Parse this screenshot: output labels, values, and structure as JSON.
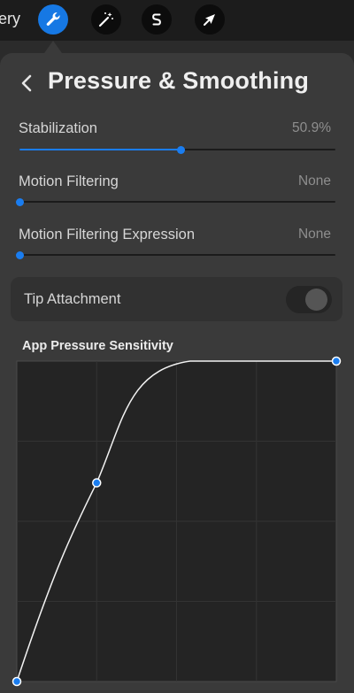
{
  "toolbar": {
    "gallery_label": "ery",
    "tools": [
      {
        "icon": "wrench-icon",
        "active": true
      },
      {
        "icon": "magic-wand-icon",
        "active": false
      },
      {
        "icon": "selection-icon",
        "active": false
      },
      {
        "icon": "transform-arrow-icon",
        "active": false
      }
    ]
  },
  "panel": {
    "title": "Pressure & Smoothing",
    "back_icon": "chevron-left-icon"
  },
  "settings": {
    "stabilization": {
      "label": "Stabilization",
      "value_text": "50.9%",
      "value": 0.509
    },
    "motion_filtering": {
      "label": "Motion Filtering",
      "value_text": "None",
      "value": 0
    },
    "motion_filtering_expression": {
      "label": "Motion Filtering Expression",
      "value_text": "None",
      "value": 0
    }
  },
  "tip_attachment": {
    "label": "Tip Attachment",
    "enabled": false
  },
  "pressure_curve": {
    "title": "App Pressure Sensitivity",
    "control_points": [
      [
        0,
        0
      ],
      [
        0.25,
        0.62
      ],
      [
        1,
        1
      ]
    ],
    "accent": "#1a7df0"
  },
  "colors": {
    "accent": "#1678e4",
    "panel": "#3a3a3a",
    "toolbar": "#1c1c1c"
  }
}
